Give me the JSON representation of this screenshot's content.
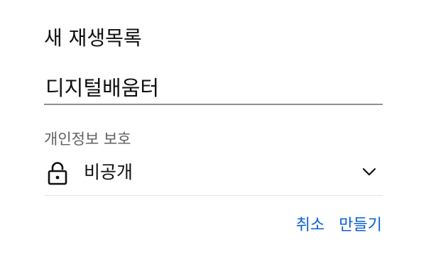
{
  "dialog": {
    "title": "새 재생목록",
    "name_input": {
      "value": "디지털배움터",
      "placeholder": ""
    },
    "privacy": {
      "label": "개인정보 보호",
      "selected": "비공개",
      "icon": "lock-icon"
    },
    "actions": {
      "cancel_label": "취소",
      "create_label": "만들기"
    },
    "colors": {
      "accent": "#065fd4",
      "text": "#0f0f0f",
      "secondary_text": "#606060",
      "underline": "#909090"
    }
  }
}
